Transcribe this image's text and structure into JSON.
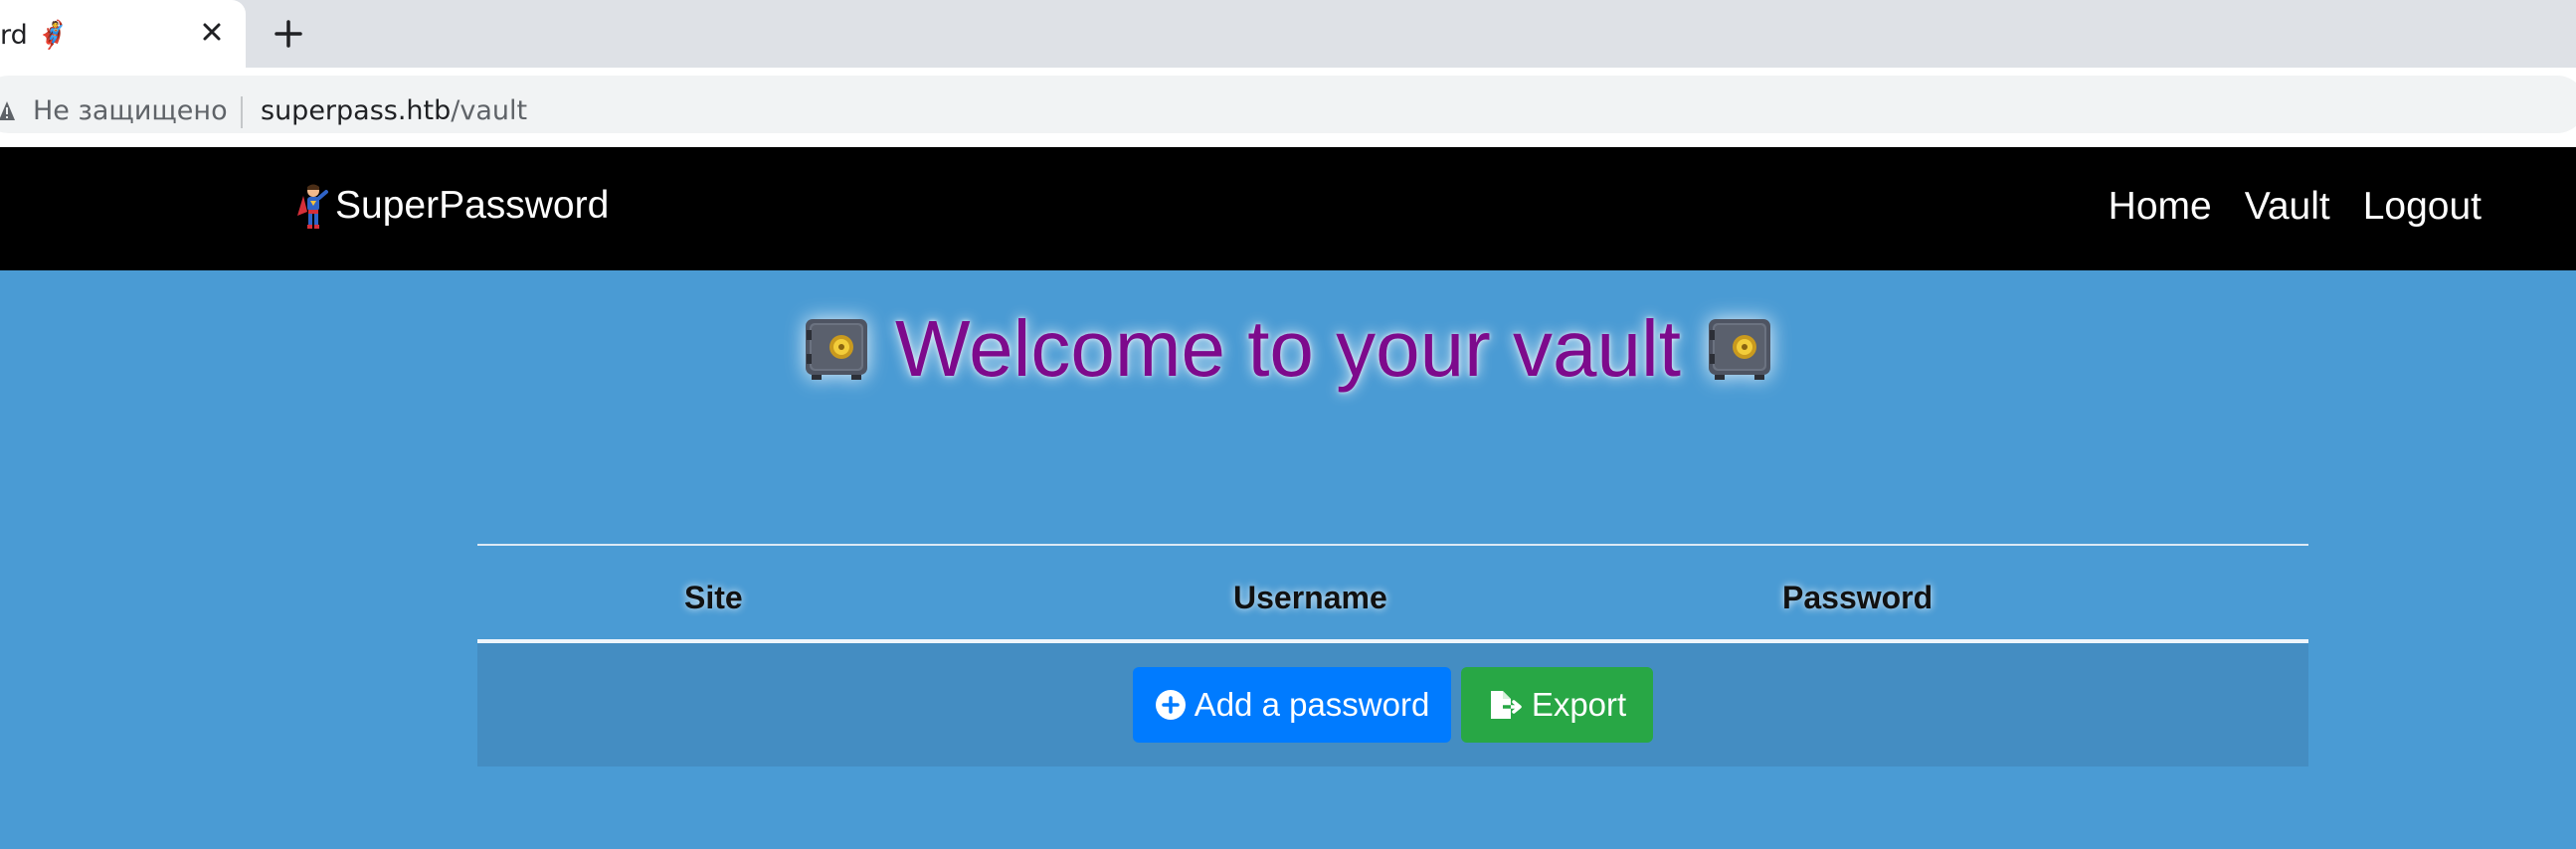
{
  "browser": {
    "tab_title": "rd 🦸",
    "security_label": "Не защищено",
    "url_host": "superpass.htb",
    "url_path": "/vault"
  },
  "navbar": {
    "brand_label": "SuperPassword",
    "links": [
      {
        "label": "Home"
      },
      {
        "label": "Vault"
      },
      {
        "label": "Logout"
      }
    ]
  },
  "page": {
    "heading": "Welcome to your vault"
  },
  "table": {
    "columns": [
      "Site",
      "Username",
      "Password"
    ]
  },
  "actions": {
    "add_label": "Add a password",
    "export_label": "Export"
  },
  "colors": {
    "page_bg": "#4a9bd4",
    "navbar_bg": "#000000",
    "heading": "#7d0a8c",
    "add_button": "#007bff",
    "export_button": "#28a745"
  },
  "icons": {
    "tab_close": "close-icon",
    "new_tab": "plus-icon",
    "security": "warning-icon",
    "brand": "superhero-icon",
    "heading": "safe-icon",
    "add": "plus-circle-icon",
    "export": "file-export-icon"
  }
}
